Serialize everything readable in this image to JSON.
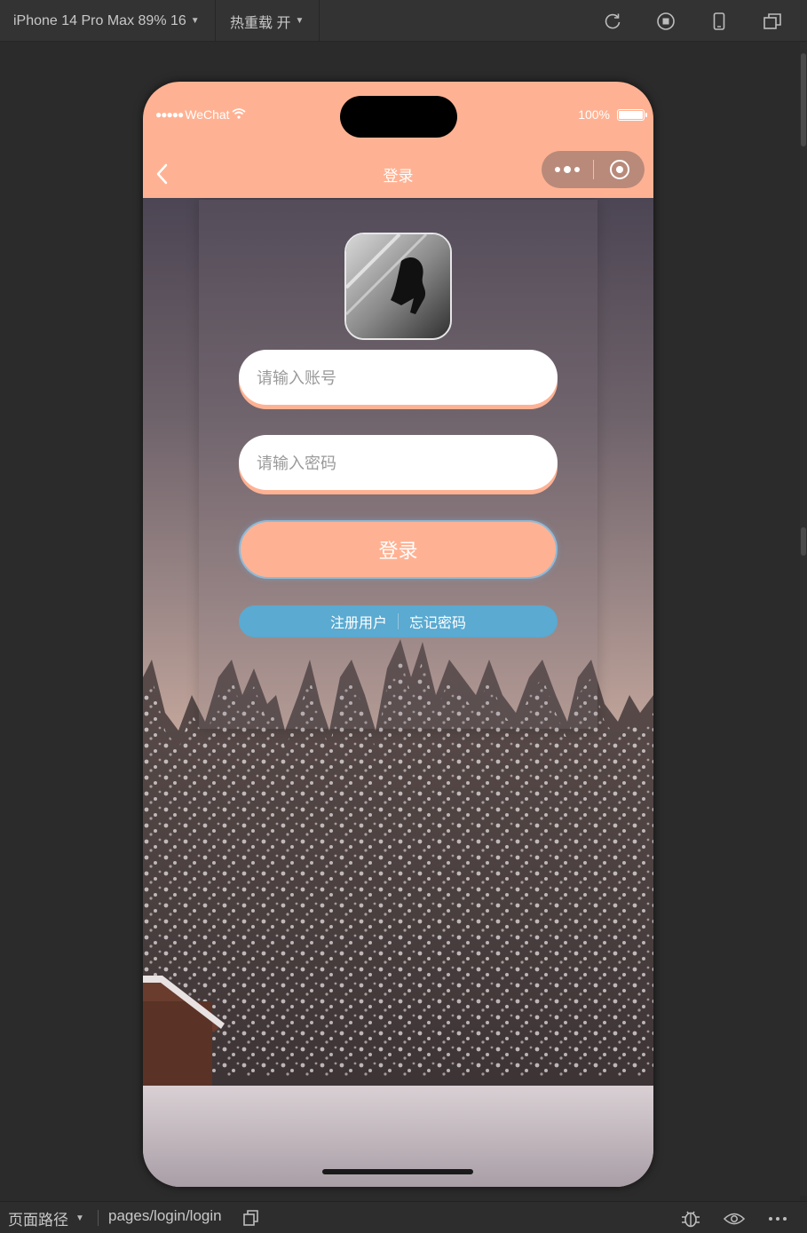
{
  "toolbar": {
    "device": "iPhone 14 Pro Max 89% 16",
    "hot_reload": "热重载 开"
  },
  "status_bar": {
    "signal": "●●●●●",
    "carrier": "WeChat",
    "battery": "100%"
  },
  "nav": {
    "title": "登录"
  },
  "form": {
    "account_placeholder": "请输入账号",
    "password_placeholder": "请输入密码",
    "login_label": "登录",
    "register_label": "注册用户",
    "forgot_label": "忘记密码"
  },
  "bottom_bar": {
    "path_label": "页面路径",
    "route": "pages/login/login"
  },
  "colors": {
    "accent": "#ffb293",
    "link_bar": "#5aaad1",
    "ide_bg": "#2b2b2b"
  },
  "icons": [
    "chevron-down-icon",
    "refresh-icon",
    "stop-icon",
    "phone-icon",
    "window-icon",
    "wifi-icon",
    "battery-icon",
    "back-icon",
    "more-icon",
    "close-mini-icon",
    "copy-icon",
    "bug-icon",
    "eye-icon",
    "ellipsis-icon"
  ]
}
